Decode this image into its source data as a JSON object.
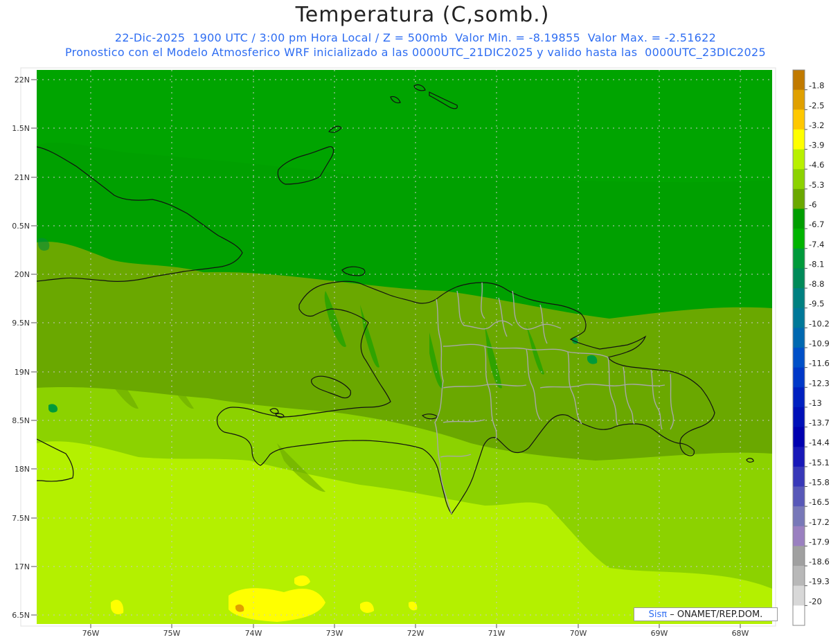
{
  "header": {
    "title": "Temperatura (C,somb.)",
    "subtitle_line1": "22-Dic-2025  1900 UTC / 3:00 pm Hora Local / Z = 500mb  Valor Min. = -8.19855  Valor Max. = -2.51622",
    "subtitle_line2": "Pronostico con el Modelo Atmosferico WRF inicializado a las 0000UTC_21DIC2025 y valido hasta las  0000UTC_23DIC2025"
  },
  "axes": {
    "lat_labels": [
      "22N",
      "1.5N",
      "21N",
      "0.5N",
      "20N",
      "9.5N",
      "19N",
      "8.5N",
      "18N",
      "7.5N",
      "17N",
      "6.5N"
    ],
    "lon_labels": [
      "76W",
      "75W",
      "74W",
      "73W",
      "72W",
      "71W",
      "70W",
      "69W",
      "68W"
    ]
  },
  "colorbar": {
    "labels": [
      "-1.8",
      "-2.5",
      "-3.2",
      "-3.9",
      "-4.6",
      "-5.3",
      "-6",
      "-6.7",
      "-7.4",
      "-8.1",
      "-8.8",
      "-9.5",
      "-10.2",
      "-10.9",
      "-11.6",
      "-12.3",
      "-13",
      "-13.7",
      "-14.4",
      "-15.1",
      "-15.8",
      "-16.5",
      "-17.2",
      "-17.9",
      "-18.6",
      "-19.3",
      "-20"
    ],
    "colors": [
      "#c17a00",
      "#e0a000",
      "#ffc800",
      "#ffff00",
      "#b8f000",
      "#8cd200",
      "#6aa800",
      "#009e00",
      "#00b400",
      "#009a3a",
      "#008a58",
      "#008080",
      "#007898",
      "#0068b0",
      "#0050c8",
      "#0038c8",
      "#0020c0",
      "#0010b8",
      "#0000b0",
      "#1818b8",
      "#3838b8",
      "#5858b8",
      "#7878b8",
      "#9a80c0",
      "#a0a0a0",
      "#b8b8b8",
      "#d8d8d8",
      "#ffffff"
    ]
  },
  "legend": {
    "brand": "Sisπ",
    "credit": "– ONAMET/REP.DOM."
  }
}
